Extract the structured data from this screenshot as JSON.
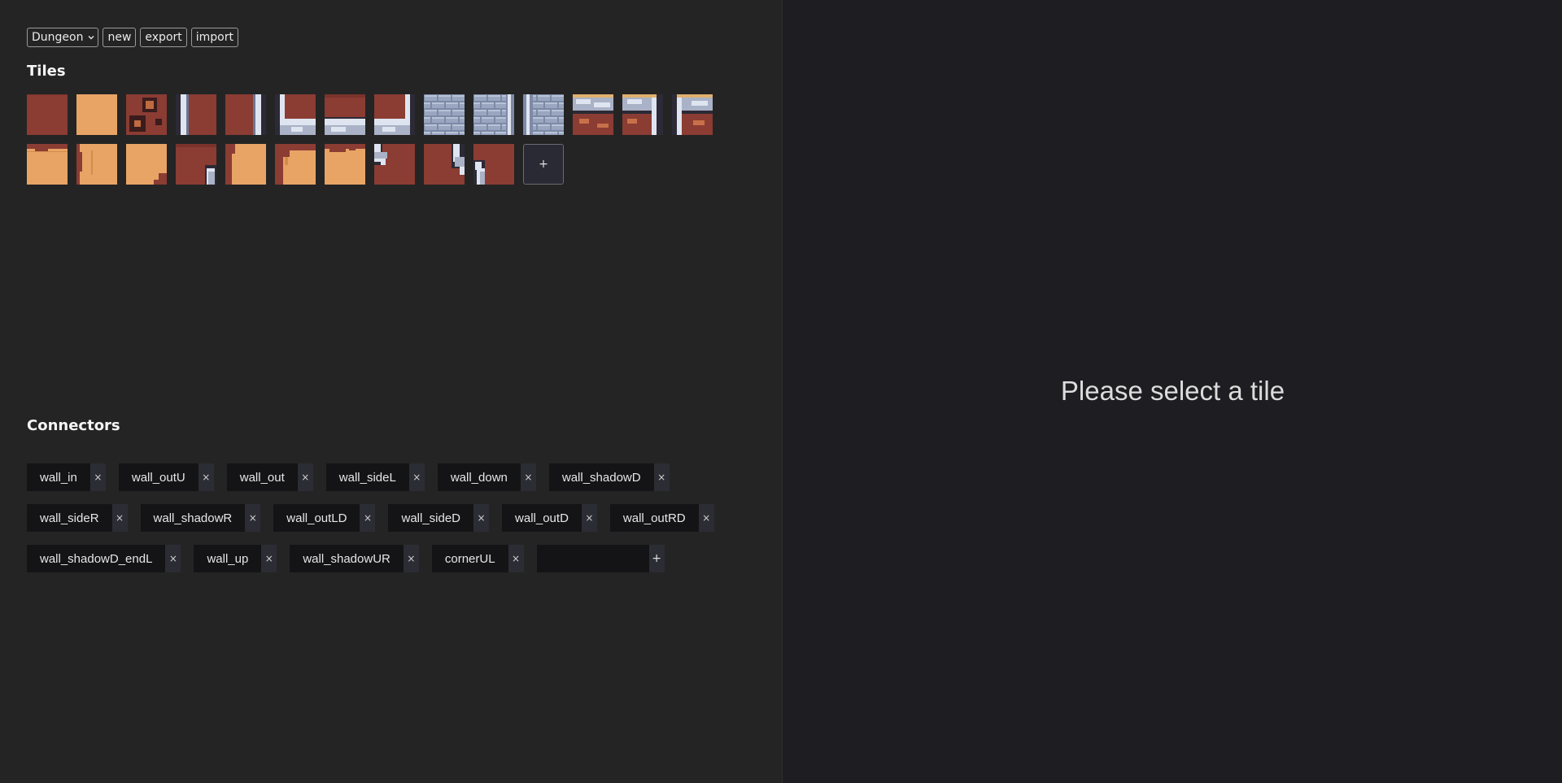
{
  "toolbar": {
    "tileset_selected": "Dungeon",
    "new_label": "new",
    "export_label": "export",
    "import_label": "import"
  },
  "tiles_section": {
    "heading": "Tiles",
    "add_label": "+",
    "tiles": [
      {
        "kind": "floor-red"
      },
      {
        "kind": "floor-sand"
      },
      {
        "kind": "floor-red-pit"
      },
      {
        "kind": "wall-side-left"
      },
      {
        "kind": "wall-side-right"
      },
      {
        "kind": "wall-corner-down-left"
      },
      {
        "kind": "wall-bottom"
      },
      {
        "kind": "wall-corner-down-right"
      },
      {
        "kind": "brick-wall"
      },
      {
        "kind": "brick-wall-right"
      },
      {
        "kind": "brick-wall-left"
      },
      {
        "kind": "wall-top-face"
      },
      {
        "kind": "wall-top-face-right"
      },
      {
        "kind": "wall-top-face-left"
      },
      {
        "kind": "sand-edge-top"
      },
      {
        "kind": "sand-edge-left"
      },
      {
        "kind": "sand-corner-br"
      },
      {
        "kind": "red-shadow-corner"
      },
      {
        "kind": "sand-edge-right"
      },
      {
        "kind": "sand-curve-tl"
      },
      {
        "kind": "sand-edge-top-2"
      },
      {
        "kind": "red-wall-corner-ul"
      },
      {
        "kind": "red-wall-corner-ur"
      },
      {
        "kind": "red-wall-end"
      }
    ]
  },
  "connectors_section": {
    "heading": "Connectors",
    "remove_label": "×",
    "add_label": "+",
    "new_value": "",
    "items": [
      "wall_in",
      "wall_outU",
      "wall_out",
      "wall_sideL",
      "wall_down",
      "wall_shadowD",
      "wall_sideR",
      "wall_shadowR",
      "wall_outLD",
      "wall_sideD",
      "wall_outD",
      "wall_outRD",
      "wall_shadowD_endL",
      "wall_up",
      "wall_shadowUR",
      "cornerUL"
    ]
  },
  "detail": {
    "empty_message": "Please select a tile"
  },
  "colors": {
    "left_panel_bg": "#242424",
    "right_panel_bg": "#1e1e22",
    "floor_red": "#8b3c33",
    "floor_sand": "#e8a465",
    "wall_stone": "#a9b2c6",
    "chip_bg": "#141416"
  }
}
